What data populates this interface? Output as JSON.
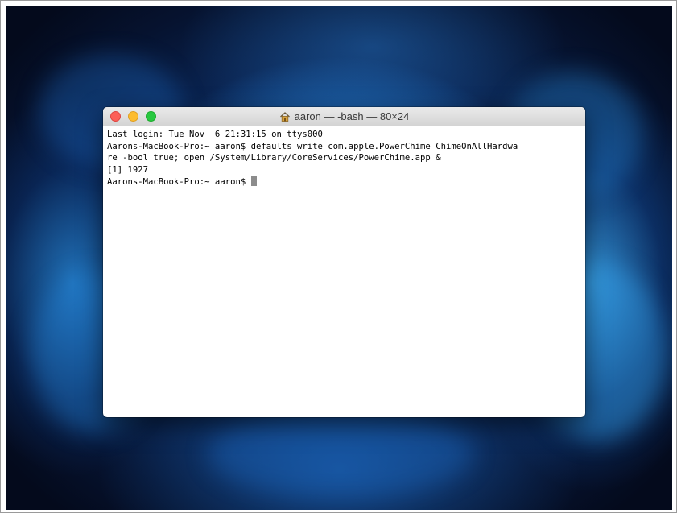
{
  "window": {
    "title": "aaron — -bash — 80×24"
  },
  "terminal": {
    "lines": [
      "Last login: Tue Nov  6 21:31:15 on ttys000",
      "Aarons-MacBook-Pro:~ aaron$ defaults write com.apple.PowerChime ChimeOnAllHardwa",
      "re -bool true; open /System/Library/CoreServices/PowerChime.app &",
      "[1] 1927"
    ],
    "prompt": "Aarons-MacBook-Pro:~ aaron$ "
  },
  "icons": {
    "title_icon": "home-icon",
    "close": "close-button",
    "minimize": "minimize-button",
    "zoom": "zoom-button"
  },
  "colors": {
    "close": "#fc5f57",
    "minimize": "#fdbc2e",
    "zoom": "#28c840",
    "cursor": "#8c8c8c"
  }
}
